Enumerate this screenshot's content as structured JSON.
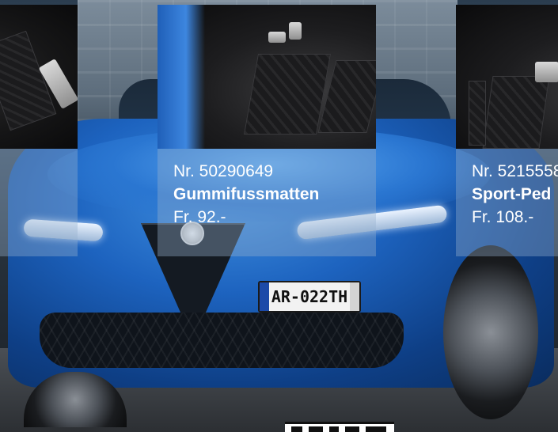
{
  "products": [
    {
      "number": "",
      "title": "",
      "price": ""
    },
    {
      "number": "Nr. 50290649",
      "title": "Gummifussmatten",
      "price": "Fr. 92.-"
    },
    {
      "number": "Nr. 5215558",
      "title": "Sport-Ped",
      "price": "Fr. 108.-"
    }
  ],
  "car": {
    "license_plate": "AR-022TH"
  },
  "colors": {
    "car_blue": "#1d63bf",
    "card_overlay": "#96afcd",
    "text": "#ffffff"
  }
}
